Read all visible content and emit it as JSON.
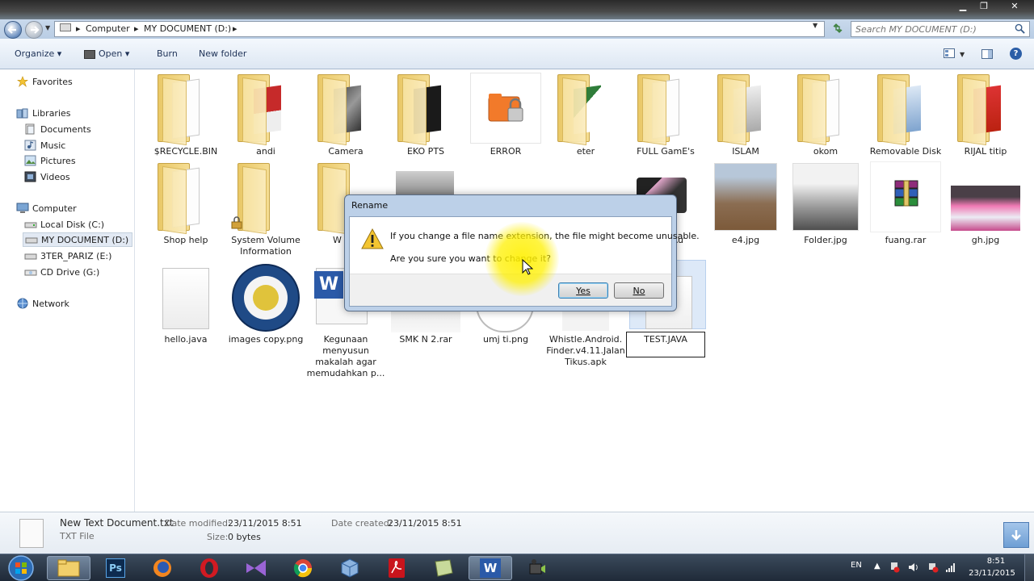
{
  "window": {
    "controls": {
      "minimize": "▁",
      "maximize": "❐",
      "close": "✕"
    }
  },
  "address": {
    "crumbs": [
      "Computer",
      "MY DOCUMENT (D:)"
    ],
    "separator": "▸",
    "search_placeholder": "Search MY DOCUMENT (D:)"
  },
  "toolbar": {
    "organize": "Organize ▾",
    "open": "Open ▾",
    "burn": "Burn",
    "new_folder": "New folder"
  },
  "sidebar": {
    "favorites": "Favorites",
    "libraries": "Libraries",
    "documents": "Documents",
    "music": "Music",
    "pictures": "Pictures",
    "videos": "Videos",
    "computer": "Computer",
    "local_disk_c": "Local Disk (C:)",
    "my_document_d": "MY DOCUMENT (D:)",
    "ter_pariz_e": "3TER_PARIZ (E:)",
    "cd_drive_g": "CD Drive (G:)",
    "network": "Network"
  },
  "files": {
    "recycle": "$RECYCLE.BIN",
    "andi": "andi",
    "camera": "Camera",
    "eko": "EKO PTS",
    "error": "ERROR",
    "eter": "eter",
    "fullgame": "FULL GamE's",
    "islam": "ISLAM",
    "okom": "okom",
    "removable": "Removable Disk",
    "rijal": "RIJAL titip",
    "shophelp": "Shop help",
    "sysvol": "System Volume Information",
    "w": "W",
    "ysau": "ysAu",
    "e4": "e4.jpg",
    "folderjpg": "Folder.jpg",
    "fuang": "fuang.rar",
    "gh": "gh.jpg",
    "hello": "hello.java",
    "images": "images copy.png",
    "kegunaan": "Kegunaan menyusun makalah agar memudahkan p...",
    "smk": "SMK N 2.rar",
    "umj": "umj ti.png",
    "whistle": "Whistle.Android. Finder.v4.11.Jalan Tikus.apk",
    "test": "TEST.JAVA"
  },
  "dialog": {
    "title": "Rename",
    "message1": "If you change a file name extension, the file might become unusable.",
    "message2": "Are you sure you want to change it?",
    "yes": "Yes",
    "no": "No"
  },
  "details": {
    "name": "New Text Document.txt",
    "type": "TXT File",
    "date_modified_label": "Date modified:",
    "date_modified": "23/11/2015 8:51",
    "size_label": "Size:",
    "size": "0 bytes",
    "date_created_label": "Date created:",
    "date_created": "23/11/2015 8:51"
  },
  "taskbar": {
    "ps_label": "Ps",
    "word_label": "W",
    "language": "EN",
    "time": "8:51",
    "date": "23/11/2015"
  },
  "colors": {
    "accent": "#2b5ea7",
    "highlight": "#fff000",
    "folder": "#f5dd93"
  }
}
